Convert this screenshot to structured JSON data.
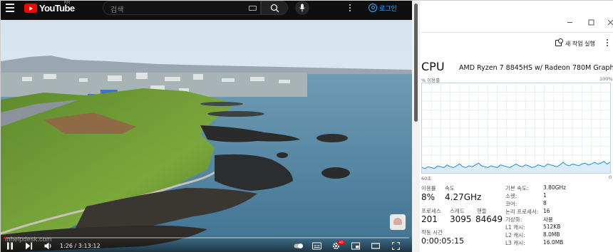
{
  "youtube": {
    "logo_text": "YouTube",
    "region": "KR",
    "search_placeholder": "검색",
    "login_label": "로그인",
    "player": {
      "current_time": "1:26",
      "duration": "3:13:12",
      "time_display": "1:26 / 3:13:12",
      "progress_fraction": 0.0074,
      "overlay_watermark": "mhelpdesk.com",
      "settings_badge": "HD"
    }
  },
  "task_manager": {
    "new_task_label": "새 작업 실행",
    "title": "CPU",
    "cpu_name": "AMD Ryzen 7 8845HS w/ Radeon 780M Graphics",
    "graph": {
      "top_left_label": "% 이용률",
      "top_right_label": "100%",
      "bottom_left_label": "60초",
      "bottom_right_label": "0",
      "line_color": "#1f8fd1",
      "fill_color": "#dbecf8",
      "utilization_series": [
        6,
        5,
        7,
        6,
        5,
        8,
        7,
        6,
        9,
        7,
        6,
        8,
        10,
        7,
        6,
        8,
        7,
        9,
        11,
        8,
        7,
        6,
        8,
        7,
        6,
        9,
        8,
        7,
        6,
        8,
        10,
        8,
        7,
        9,
        8,
        6,
        7,
        9,
        8,
        7,
        10,
        9,
        8,
        7,
        9,
        12,
        9,
        8,
        10,
        9,
        8,
        10,
        11,
        9,
        10,
        12,
        10,
        11,
        13,
        10,
        12
      ]
    },
    "stats": {
      "util_label": "이용률",
      "util_value": "8%",
      "speed_label": "속도",
      "speed_value": "4.27GHz",
      "proc_label": "프로세스",
      "proc_value": "201",
      "thread_label": "스레드",
      "thread_value": "3095",
      "handle_label": "핸들",
      "handle_value": "84649",
      "uptime_label": "작동 시간",
      "uptime_value": "0:00:05:15"
    },
    "specs": [
      {
        "k": "기본 속도:",
        "v": "3.80GHz"
      },
      {
        "k": "소켓:",
        "v": "1"
      },
      {
        "k": "코어:",
        "v": "8"
      },
      {
        "k": "논리 프로세서:",
        "v": "16"
      },
      {
        "k": "가상화:",
        "v": "사용"
      },
      {
        "k": "L1 캐시:",
        "v": "512KB"
      },
      {
        "k": "L2 캐시:",
        "v": "8.0MB"
      },
      {
        "k": "L3 캐시:",
        "v": "16.0MB"
      }
    ]
  }
}
